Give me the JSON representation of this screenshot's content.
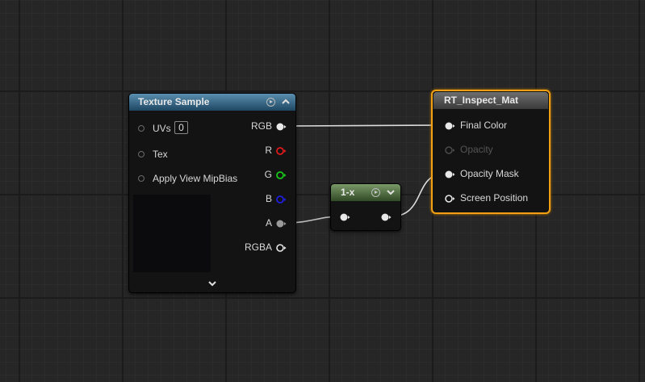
{
  "texture_sample": {
    "title": "Texture Sample",
    "inputs": {
      "uvs": "UVs",
      "uvs_value": "0",
      "tex": "Tex",
      "apply_view_mipbias": "Apply View MipBias"
    },
    "outputs": {
      "rgb": "RGB",
      "r": "R",
      "g": "G",
      "b": "B",
      "a": "A",
      "rgba": "RGBA"
    }
  },
  "one_minus": {
    "title": "1-x"
  },
  "material": {
    "title": "RT_Inspect_Mat",
    "inputs": {
      "final_color": "Final Color",
      "opacity": "Opacity",
      "opacity_mask": "Opacity Mask",
      "screen_position": "Screen Position"
    }
  },
  "colors": {
    "r_pin": "#e01a1a",
    "g_pin": "#17c817",
    "b_pin": "#1f1fe0",
    "a_pin": "#9a9a9a",
    "selection": "#f1a011",
    "wire": "#d9d9d9"
  }
}
